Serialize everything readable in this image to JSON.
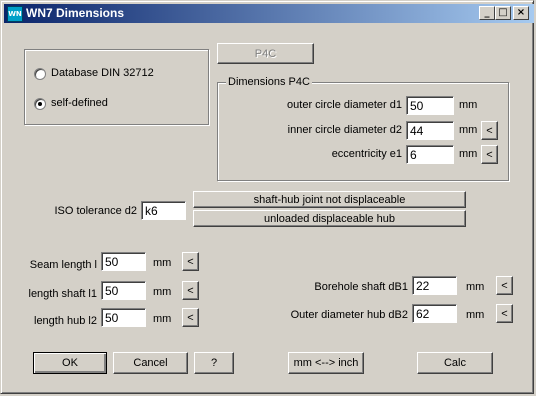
{
  "window": {
    "title": "WN7 Dimensions",
    "icon_label": "WN",
    "controls": {
      "minimize": "_",
      "maximize": "□",
      "close": "×"
    }
  },
  "source_group": {
    "options": [
      {
        "label": "Database DIN 32712",
        "checked": false
      },
      {
        "label": "self-defined",
        "checked": true
      }
    ]
  },
  "profile_button": "P4C",
  "dimensions_group": {
    "title": "Dimensions P4C",
    "rows": [
      {
        "label": "outer circle diameter d1",
        "value": "50",
        "unit": "mm",
        "has_button": false
      },
      {
        "label": "inner circle diameter d2",
        "value": "44",
        "unit": "mm",
        "has_button": true,
        "button_label": "<"
      },
      {
        "label": "eccentricity e1",
        "value": "6",
        "unit": "mm",
        "has_button": true,
        "button_label": "<"
      }
    ]
  },
  "iso_tolerance": {
    "label": "ISO tolerance d2",
    "value": "k6"
  },
  "joint_buttons": {
    "fixed": "shaft-hub joint not displaceable",
    "displaceable": "unloaded displaceable hub"
  },
  "lengths": [
    {
      "label": "Seam length l",
      "value": "50",
      "unit": "mm",
      "button_label": "<"
    },
    {
      "label": "length shaft l1",
      "value": "50",
      "unit": "mm",
      "button_label": "<"
    },
    {
      "label": "length hub l2",
      "value": "50",
      "unit": "mm",
      "button_label": "<"
    }
  ],
  "diameters": [
    {
      "label": "Borehole shaft dB1",
      "value": "22",
      "unit": "mm",
      "button_label": "<"
    },
    {
      "label": "Outer diameter hub dB2",
      "value": "62",
      "unit": "mm",
      "button_label": "<"
    }
  ],
  "footer": {
    "ok": "OK",
    "cancel": "Cancel",
    "help": "?",
    "units": "mm <--> inch",
    "calc": "Calc"
  }
}
